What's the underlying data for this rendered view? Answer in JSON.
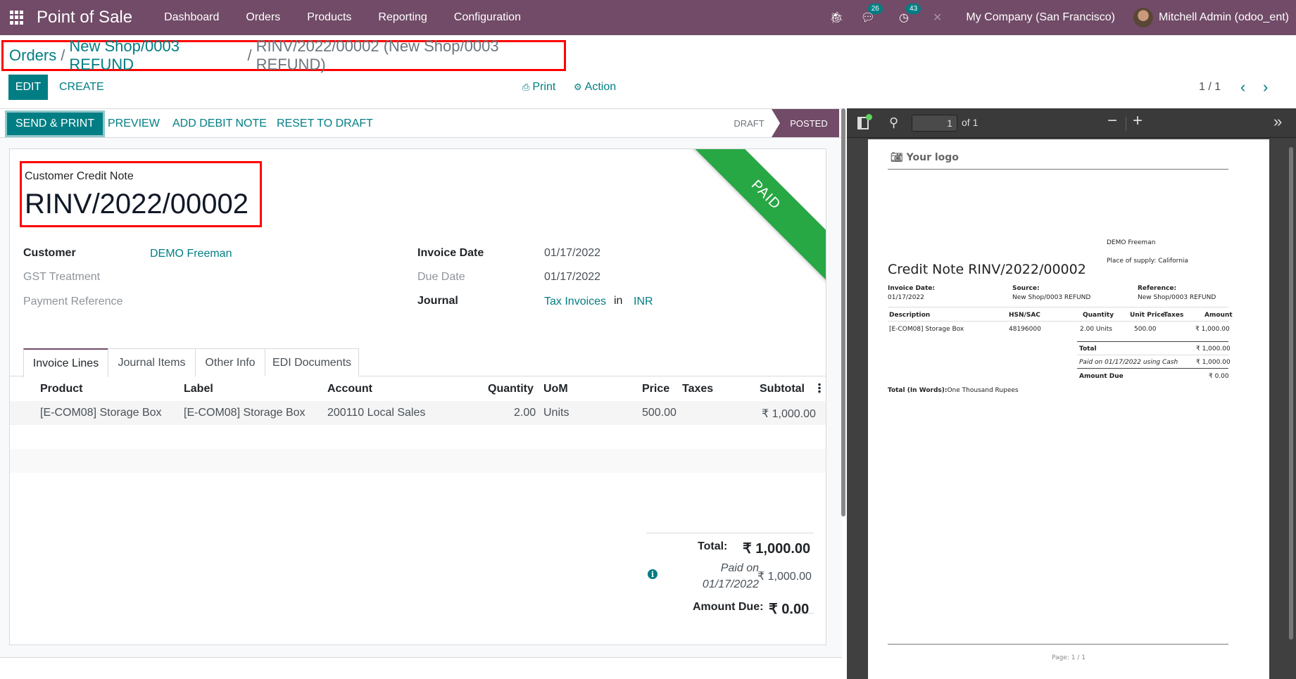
{
  "navbar": {
    "app_name": "Point of Sale",
    "menu": [
      "Dashboard",
      "Orders",
      "Products",
      "Reporting",
      "Configuration"
    ],
    "messages_count": "26",
    "activities_count": "43",
    "company": "My Company (San Francisco)",
    "user": "Mitchell Admin (odoo_ent)"
  },
  "breadcrumb": {
    "items": [
      "Orders",
      "New Shop/0003 REFUND"
    ],
    "current": "RINV/2022/00002 (New Shop/0003 REFUND)",
    "separator": "/"
  },
  "control_panel": {
    "edit_label": "EDIT",
    "create_label": "CREATE",
    "print_label": "Print",
    "action_label": "Action",
    "pager_value": "1 / 1",
    "prev_icon": "‹",
    "next_icon": "›"
  },
  "statusbar": {
    "buttons": [
      "SEND & PRINT",
      "PREVIEW",
      "ADD DEBIT NOTE",
      "RESET TO DRAFT"
    ],
    "states": [
      "DRAFT",
      "POSTED"
    ],
    "active_state": "POSTED"
  },
  "form": {
    "ribbon": "PAID",
    "doc_type": "Customer Credit Note",
    "doc_name": "RINV/2022/00002",
    "left_fields": [
      {
        "label": "Customer",
        "value": "DEMO Freeman"
      },
      {
        "label": "GST Treatment",
        "value": ""
      },
      {
        "label": "Payment Reference",
        "value": ""
      }
    ],
    "right_fields": [
      {
        "label": "Invoice Date",
        "value": "01/17/2022"
      },
      {
        "label": "Due Date",
        "value": "01/17/2022"
      },
      {
        "label": "Journal",
        "value": "Tax Invoices",
        "connector": "in",
        "currency": "INR"
      }
    ],
    "tabs": [
      "Invoice Lines",
      "Journal Items",
      "Other Info",
      "EDI Documents"
    ],
    "active_tab": "Invoice Lines",
    "lines_table": {
      "columns": [
        "Product",
        "Label",
        "Account",
        "Quantity",
        "UoM",
        "Price",
        "Taxes",
        "Subtotal"
      ],
      "rows": [
        [
          "[E-COM08] Storage Box",
          "[E-COM08] Storage Box",
          "200110 Local Sales",
          "2.00",
          "Units",
          "500.00",
          "",
          "₹ 1,000.00"
        ]
      ]
    },
    "totals": {
      "total_label": "Total:",
      "total_value": "₹ 1,000.00",
      "paid_label_1": "Paid on",
      "paid_label_2": "01/17/2022",
      "paid_value": "₹ 1,000.00",
      "due_label": "Amount Due:",
      "due_value": "₹ 0.00"
    }
  },
  "pdf_viewer": {
    "page_input": "1",
    "page_of": "of 1",
    "zoom_out": "−",
    "zoom_in": "+",
    "more": "»",
    "doc": {
      "logo": "Your logo",
      "customer": "DEMO Freeman",
      "place_of_supply": "Place of supply: California",
      "title": "Credit Note RINV/2022/00002",
      "info": [
        {
          "label": "Invoice Date:",
          "value": "01/17/2022"
        },
        {
          "label": "Source:",
          "value": "New Shop/0003 REFUND"
        },
        {
          "label": "Reference:",
          "value": "New Shop/0003 REFUND"
        }
      ],
      "columns": [
        "Description",
        "HSN/SAC",
        "Quantity",
        "Unit Price",
        "Taxes",
        "Amount"
      ],
      "rows": [
        [
          "[E-COM08] Storage Box",
          "48196000",
          "2.00 Units",
          "500.00",
          "",
          "₹ 1,000.00"
        ]
      ],
      "total_label": "Total",
      "total_value": "₹ 1,000.00",
      "paid_label": "Paid on 01/17/2022 using Cash",
      "paid_value": "₹ 1,000.00",
      "due_label": "Amount Due",
      "due_value": "₹ 0.00",
      "words_label": "Total (In Words):",
      "words_value": "One Thousand Rupees",
      "footer": "Page: 1 / 1"
    }
  }
}
